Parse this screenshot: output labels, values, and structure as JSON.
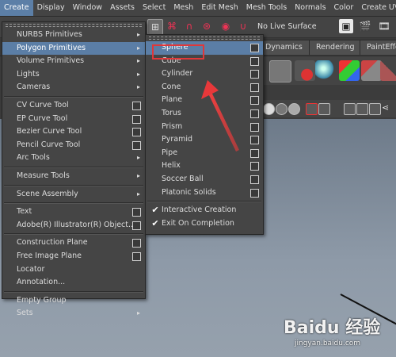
{
  "menubar": {
    "items": [
      "Create",
      "Display",
      "Window",
      "Assets",
      "Select",
      "Mesh",
      "Edit Mesh",
      "Mesh Tools",
      "Normals",
      "Color",
      "Create UVs"
    ]
  },
  "toolbar": {
    "live_surface": "No Live Surface"
  },
  "shelf_tabs": [
    "Dynamics",
    "Rendering",
    "PaintEffe"
  ],
  "create_menu": {
    "items": [
      {
        "label": "NURBS Primitives",
        "type": "submenu"
      },
      {
        "label": "Polygon Primitives",
        "type": "submenu",
        "highlighted": true
      },
      {
        "label": "Volume Primitives",
        "type": "submenu"
      },
      {
        "label": "Lights",
        "type": "submenu"
      },
      {
        "label": "Cameras",
        "type": "submenu"
      },
      {
        "type": "separator"
      },
      {
        "label": "CV Curve Tool",
        "type": "option"
      },
      {
        "label": "EP Curve Tool",
        "type": "option"
      },
      {
        "label": "Bezier Curve Tool",
        "type": "option"
      },
      {
        "label": "Pencil Curve Tool",
        "type": "option"
      },
      {
        "label": "Arc Tools",
        "type": "submenu"
      },
      {
        "type": "separator"
      },
      {
        "label": "Measure Tools",
        "type": "submenu"
      },
      {
        "type": "separator"
      },
      {
        "label": "Scene Assembly",
        "type": "submenu"
      },
      {
        "type": "separator"
      },
      {
        "label": "Text",
        "type": "option"
      },
      {
        "label": "Adobe(R) Illustrator(R) Object...",
        "type": "option"
      },
      {
        "type": "separator"
      },
      {
        "label": "Construction Plane",
        "type": "option"
      },
      {
        "label": "Free Image Plane",
        "type": "option"
      },
      {
        "label": "Locator",
        "type": "plain"
      },
      {
        "label": "Annotation...",
        "type": "plain"
      },
      {
        "type": "separator"
      },
      {
        "label": "Empty Group",
        "type": "plain"
      },
      {
        "label": "Sets",
        "type": "submenu"
      }
    ]
  },
  "polygon_menu": {
    "items": [
      {
        "label": "Sphere",
        "type": "option",
        "highlighted": true
      },
      {
        "label": "Cube",
        "type": "option"
      },
      {
        "label": "Cylinder",
        "type": "option"
      },
      {
        "label": "Cone",
        "type": "option"
      },
      {
        "label": "Plane",
        "type": "option"
      },
      {
        "label": "Torus",
        "type": "option"
      },
      {
        "label": "Prism",
        "type": "option"
      },
      {
        "label": "Pyramid",
        "type": "option"
      },
      {
        "label": "Pipe",
        "type": "option"
      },
      {
        "label": "Helix",
        "type": "option"
      },
      {
        "label": "Soccer Ball",
        "type": "option"
      },
      {
        "label": "Platonic Solids",
        "type": "option"
      },
      {
        "type": "separator"
      },
      {
        "label": "Interactive Creation",
        "type": "check",
        "checked": true
      },
      {
        "label": "Exit On Completion",
        "type": "check",
        "checked": true
      }
    ]
  },
  "watermark": {
    "logo": "Bai⁠du 经验",
    "url": "jingyan.baidu.com"
  },
  "colors": {
    "highlight": "#5b7ea6",
    "annotation": "#e0383a"
  }
}
